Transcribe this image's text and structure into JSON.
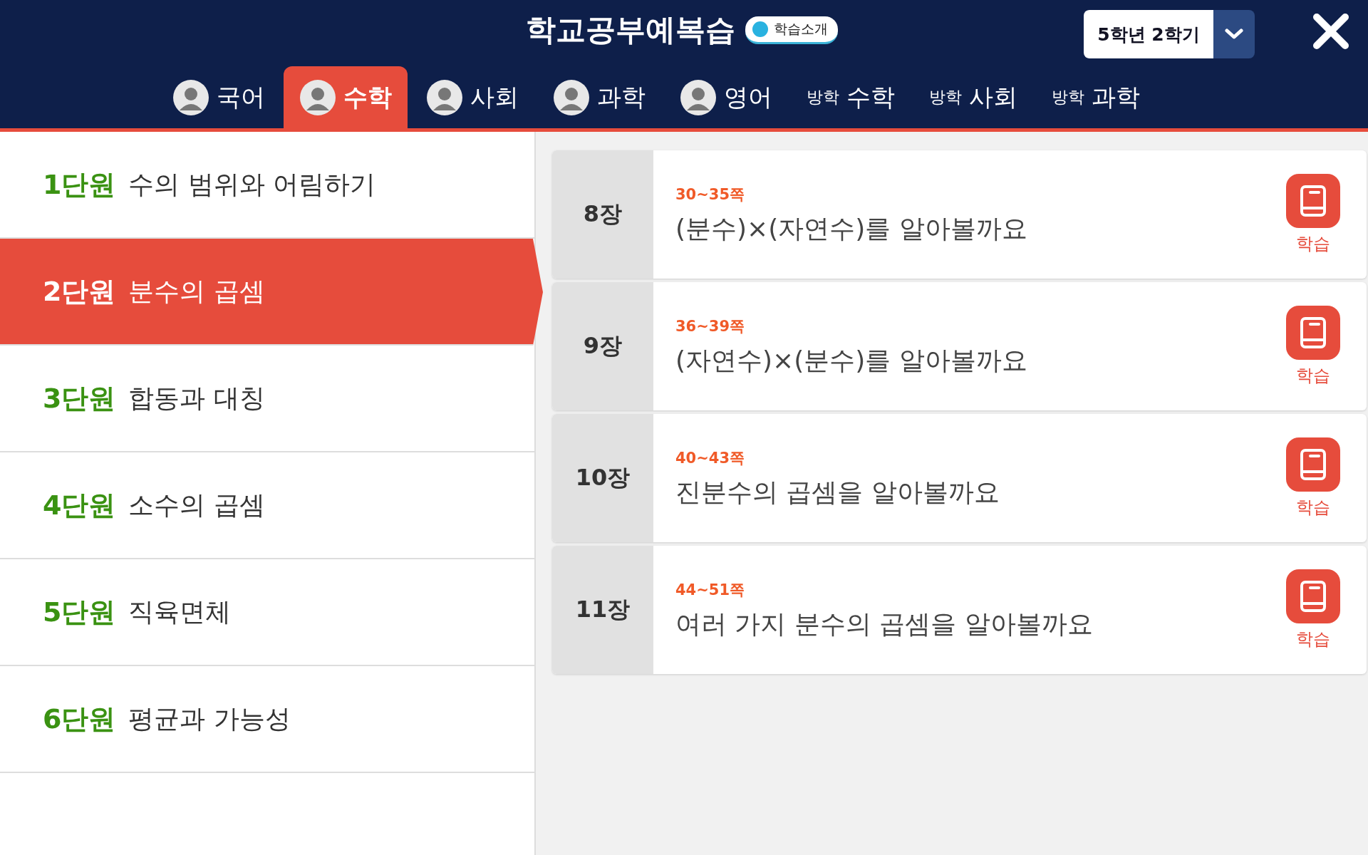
{
  "header": {
    "title": "학교공부예복습",
    "intro_badge": "학습소개",
    "grade_select": "5학년 2학기"
  },
  "tabs": [
    {
      "kind": "subject",
      "label": "국어",
      "selected": false
    },
    {
      "kind": "subject",
      "label": "수학",
      "selected": true
    },
    {
      "kind": "subject",
      "label": "사회",
      "selected": false
    },
    {
      "kind": "subject",
      "label": "과학",
      "selected": false
    },
    {
      "kind": "subject",
      "label": "영어",
      "selected": false
    },
    {
      "kind": "vacation",
      "prefix": "방학",
      "label": "수학",
      "selected": false
    },
    {
      "kind": "vacation",
      "prefix": "방학",
      "label": "사회",
      "selected": false
    },
    {
      "kind": "vacation",
      "prefix": "방학",
      "label": "과학",
      "selected": false
    }
  ],
  "units": [
    {
      "number": "1단원",
      "title": "수의 범위와 어림하기",
      "selected": false
    },
    {
      "number": "2단원",
      "title": "분수의 곱셈",
      "selected": true
    },
    {
      "number": "3단원",
      "title": "합동과 대칭",
      "selected": false
    },
    {
      "number": "4단원",
      "title": "소수의 곱셈",
      "selected": false
    },
    {
      "number": "5단원",
      "title": "직육면체",
      "selected": false
    },
    {
      "number": "6단원",
      "title": "평균과 가능성",
      "selected": false
    }
  ],
  "lessons": [
    {
      "chapter": "8장",
      "pages": "30~35쪽",
      "title": "(분수)×(자연수)를 알아볼까요",
      "button": "학습"
    },
    {
      "chapter": "9장",
      "pages": "36~39쪽",
      "title": "(자연수)×(분수)를 알아볼까요",
      "button": "학습"
    },
    {
      "chapter": "10장",
      "pages": "40~43쪽",
      "title": "진분수의 곱셈을 알아볼까요",
      "button": "학습"
    },
    {
      "chapter": "11장",
      "pages": "44~51쪽",
      "title": "여러 가지 분수의 곱셈을 알아볼까요",
      "button": "학습"
    }
  ]
}
